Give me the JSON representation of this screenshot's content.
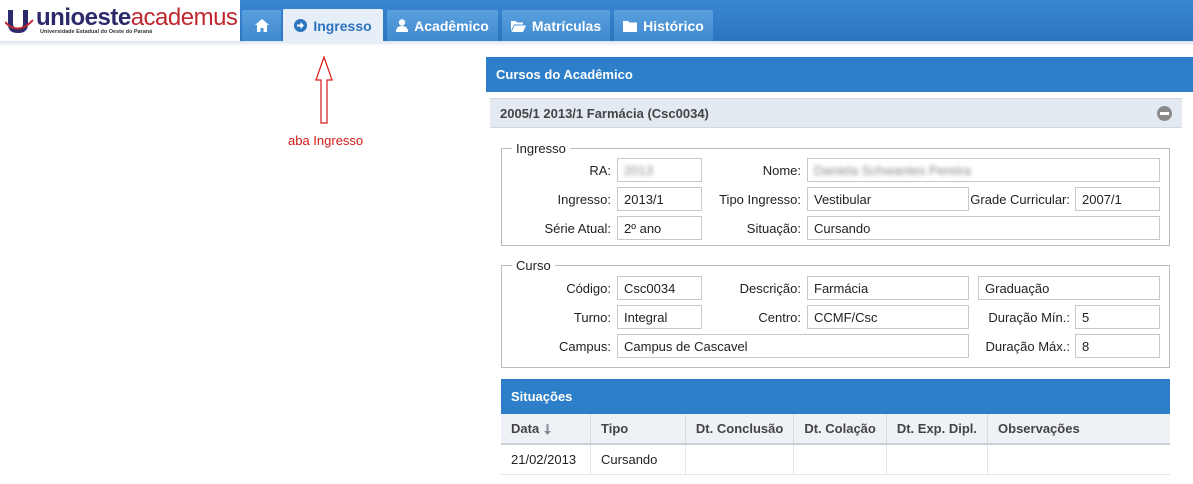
{
  "header": {
    "logo_main": "unioeste",
    "logo_accent": "academus",
    "logo_sub": "Universidade Estadual do Oeste do Paraná",
    "tabs": [
      {
        "label": "",
        "icon": "home-icon"
      },
      {
        "label": "Ingresso",
        "icon": "arrow-circle-right-icon",
        "active": true
      },
      {
        "label": "Acadêmico",
        "icon": "user-icon"
      },
      {
        "label": "Matrículas",
        "icon": "folder-open-icon"
      },
      {
        "label": "Histórico",
        "icon": "folder-icon"
      }
    ]
  },
  "annotation": {
    "text": "aba Ingresso",
    "color": "#d41a1a"
  },
  "panel": {
    "title": "Cursos do Acadêmico",
    "course_header": "2005/1 2013/1 Farmácia (Csc0034)"
  },
  "ingresso": {
    "legend": "Ingresso",
    "ra_label": "RA:",
    "ra_value": "2013",
    "nome_label": "Nome:",
    "nome_value": "Daniela Schwantes Pereira",
    "ingresso_label": "Ingresso:",
    "ingresso_value": "2013/1",
    "tipo_label": "Tipo Ingresso:",
    "tipo_value": "Vestibular",
    "grade_label": "Grade Curricular:",
    "grade_value": "2007/1",
    "serie_label": "Série Atual:",
    "serie_value": "2º ano",
    "situacao_label": "Situação:",
    "situacao_value": "Cursando"
  },
  "curso": {
    "legend": "Curso",
    "codigo_label": "Código:",
    "codigo_value": "Csc0034",
    "descricao_label": "Descrição:",
    "descricao_value": "Farmácia",
    "nivel_value": "Graduação",
    "turno_label": "Turno:",
    "turno_value": "Integral",
    "centro_label": "Centro:",
    "centro_value": "CCMF/Csc",
    "dur_min_label": "Duração Mín.:",
    "dur_min_value": "5",
    "campus_label": "Campus:",
    "campus_value": "Campus de Cascavel",
    "dur_max_label": "Duração Máx.:",
    "dur_max_value": "8"
  },
  "situacoes": {
    "title": "Situações",
    "columns": [
      "Data",
      "Tipo",
      "Dt. Conclusão",
      "Dt. Colação",
      "Dt. Exp. Dipl.",
      "Observações"
    ],
    "rows": [
      [
        "21/02/2013",
        "Cursando",
        "",
        "",
        "",
        ""
      ]
    ]
  },
  "colors": {
    "accent": "#2c7fc8",
    "tab": "#4a94d6",
    "annotation": "#d41a1a"
  }
}
